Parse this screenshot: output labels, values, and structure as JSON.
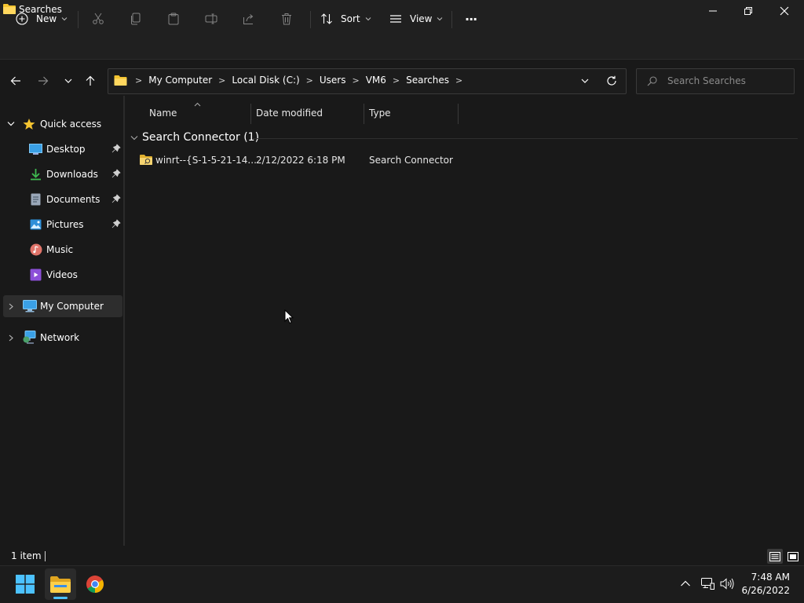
{
  "window": {
    "title": "Searches"
  },
  "toolbar": {
    "new_label": "New",
    "sort_label": "Sort",
    "view_label": "View",
    "more_label": "···"
  },
  "address": {
    "crumbs": [
      "My Computer",
      "Local Disk (C:)",
      "Users",
      "VM6",
      "Searches"
    ],
    "search_placeholder": "Search Searches"
  },
  "sidebar": {
    "quick_access": "Quick access",
    "items": [
      {
        "label": "Desktop",
        "icon": "desktop-icon",
        "pinned": true
      },
      {
        "label": "Downloads",
        "icon": "downloads-icon",
        "pinned": true
      },
      {
        "label": "Documents",
        "icon": "documents-icon",
        "pinned": true
      },
      {
        "label": "Pictures",
        "icon": "pictures-icon",
        "pinned": true
      },
      {
        "label": "Music",
        "icon": "music-icon",
        "pinned": false
      },
      {
        "label": "Videos",
        "icon": "videos-icon",
        "pinned": false
      }
    ],
    "my_computer": "My Computer",
    "network": "Network"
  },
  "columns": {
    "name": "Name",
    "date_modified": "Date modified",
    "type": "Type"
  },
  "group": {
    "label": "Search Connector (1)"
  },
  "files": [
    {
      "name": "winrt--{S-1-5-21-14...",
      "date": "2/12/2022 6:18 PM",
      "type": "Search Connector"
    }
  ],
  "status": {
    "count": "1 item"
  },
  "taskbar": {
    "time": "7:48 AM",
    "date": "6/26/2022"
  },
  "colors": {
    "accent": "#4cc2ff",
    "folder": "#f4c430",
    "background": "#191919",
    "chrome": "#202020"
  }
}
